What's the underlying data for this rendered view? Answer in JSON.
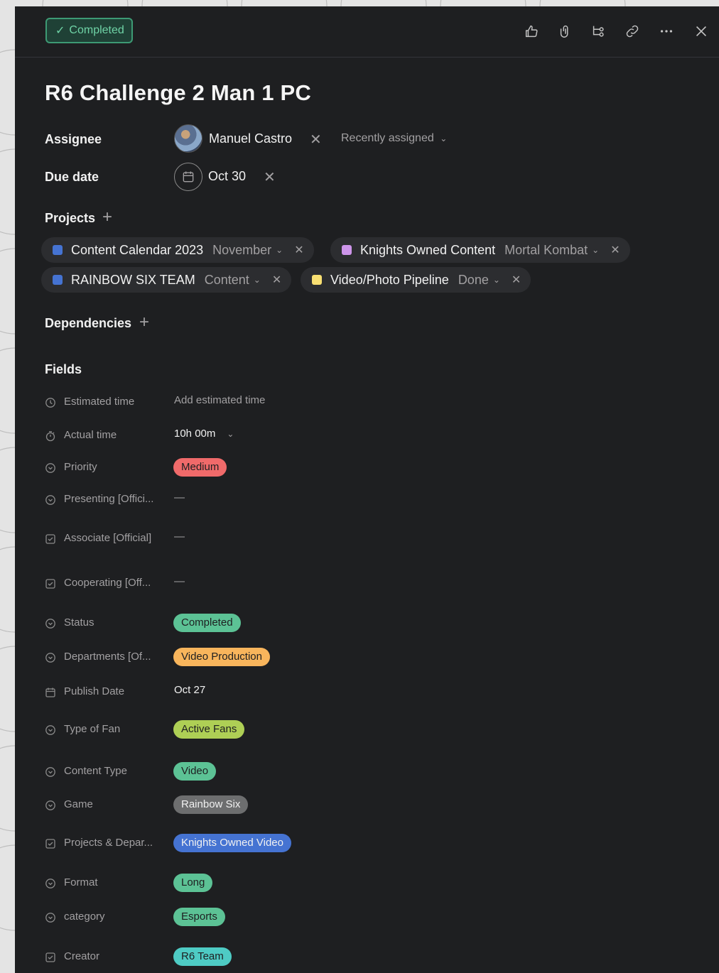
{
  "header": {
    "complete_label": "Completed",
    "icons": [
      "thumbs-up-icon",
      "attachment-icon",
      "subtask-icon",
      "link-icon",
      "more-icon",
      "close-icon"
    ]
  },
  "task": {
    "title": "R6 Challenge 2 Man 1 PC",
    "assignee_label": "Assignee",
    "assignee_name": "Manuel Castro",
    "recently_assigned": "Recently assigned",
    "due_label": "Due date",
    "due_value": "Oct 30",
    "projects_label": "Projects",
    "dependencies_label": "Dependencies",
    "fields_label": "Fields"
  },
  "projects": [
    {
      "name": "Content Calendar 2023",
      "section": "November",
      "color": "#4573d2"
    },
    {
      "name": "Knights Owned Content",
      "section": "Mortal Kombat",
      "color": "#cd95ea"
    },
    {
      "name": "RAINBOW SIX TEAM",
      "section": "Content",
      "color": "#4573d2"
    },
    {
      "name": "Video/Photo Pipeline",
      "section": "Done",
      "color": "#f8df72"
    }
  ],
  "fields": [
    {
      "name": "Estimated time",
      "value": "Add estimated time",
      "icon": "clock-icon"
    },
    {
      "name": "Actual time",
      "value": "10h 00m",
      "icon": "timer-icon"
    },
    {
      "name": "Priority",
      "value": "Medium",
      "icon": "single-select-icon",
      "pill_bg": "#f06a6a",
      "pill_fg": "#1e1f21"
    },
    {
      "name": "Presenting [Offici...",
      "value": "—",
      "icon": "single-select-icon"
    },
    {
      "name": "Associate [Official]",
      "value": "—",
      "icon": "multi-select-icon"
    },
    {
      "name": "Cooperating [Off...",
      "value": "—",
      "icon": "multi-select-icon"
    },
    {
      "name": "Status",
      "value": "Completed",
      "icon": "single-select-icon",
      "pill_bg": "#5cc295",
      "pill_fg": "#1e1f21"
    },
    {
      "name": "Departments [Of...",
      "value": "Video Production",
      "icon": "single-select-icon",
      "pill_bg": "#f8b55c",
      "pill_fg": "#1e1f21"
    },
    {
      "name": "Publish Date",
      "value": "Oct 27",
      "icon": "calendar-icon"
    },
    {
      "name": "Type of Fan",
      "value": "Active Fans",
      "icon": "single-select-icon",
      "pill_bg": "#aecf55",
      "pill_fg": "#1e1f21"
    },
    {
      "name": "Content Type",
      "value": "Video",
      "icon": "single-select-icon",
      "pill_bg": "#5cc295",
      "pill_fg": "#1e1f21"
    },
    {
      "name": "Game",
      "value": "Rainbow Six",
      "icon": "single-select-icon",
      "pill_bg": "#6d6e6f",
      "pill_fg": "#f1f1f1"
    },
    {
      "name": "Projects & Depar...",
      "value": "Knights Owned Video",
      "icon": "multi-select-icon",
      "pill_bg": "#4573d2",
      "pill_fg": "#f1f1f1"
    },
    {
      "name": "Format",
      "value": "Long",
      "icon": "single-select-icon",
      "pill_bg": "#5cc295",
      "pill_fg": "#1e1f21"
    },
    {
      "name": "category",
      "value": "Esports",
      "icon": "single-select-icon",
      "pill_bg": "#5cc295",
      "pill_fg": "#1e1f21"
    },
    {
      "name": "Creator",
      "value": "R6 Team",
      "icon": "multi-select-icon",
      "pill_bg": "#4ecbc4",
      "pill_fg": "#1e1f21"
    }
  ]
}
